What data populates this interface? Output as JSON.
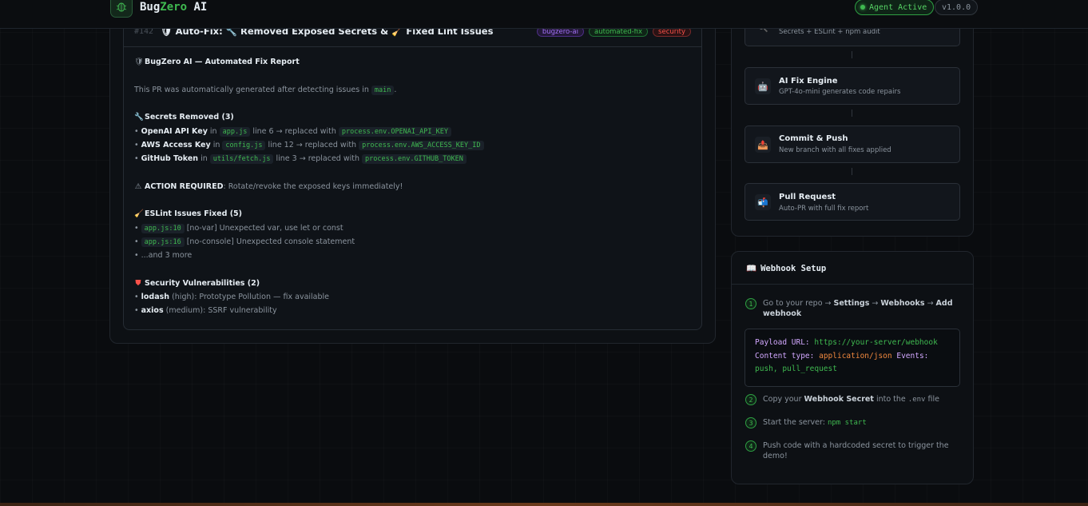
{
  "header": {
    "brand_part1": "Bug",
    "brand_part2": "Zero",
    "brand_part3": " AI",
    "status_badge": "Agent Active",
    "version": "v1.0.0"
  },
  "pr": {
    "number": "#142",
    "title": "🛡 Auto-Fix: 🔧 Removed Exposed Secrets & 🧹 Fixed Lint Issues",
    "tags": [
      "bugzero-ai",
      "automated-fix",
      "security"
    ],
    "report_title": "BugZero AI — Automated Fix Report",
    "intro_text": "This PR was automatically generated after detecting issues in",
    "intro_branch": "main",
    "intro_end": ".",
    "secrets_heading": "Secrets Removed (3)",
    "secrets": [
      {
        "name": "OpenAI API Key",
        "in": "in",
        "file": "app.js",
        "detail": "line 6 → replaced with",
        "replacement": "process.env.OPENAI_API_KEY"
      },
      {
        "name": "AWS Access Key",
        "in": "in",
        "file": "config.js",
        "detail": "line 12 → replaced with",
        "replacement": "process.env.AWS_ACCESS_KEY_ID"
      },
      {
        "name": "GitHub Token",
        "in": "in",
        "file": "utils/fetch.js",
        "detail": "line 3 → replaced with",
        "replacement": "process.env.GITHUB_TOKEN"
      }
    ],
    "action_label": "ACTION REQUIRED",
    "action_text": ": Rotate/revoke the exposed keys immediately!",
    "eslint_heading": "ESLint Issues Fixed (5)",
    "eslint": [
      {
        "loc": "app.js:10",
        "text": "[no-var] Unexpected var, use let or const"
      },
      {
        "loc": "app.js:16",
        "text": "[no-console] Unexpected console statement"
      }
    ],
    "eslint_more": "...and 3 more",
    "vuln_heading": "Security Vulnerabilities (2)",
    "vulns": [
      {
        "pkg": "lodash",
        "severity": "(high)",
        "text": ": Prototype Pollution — fix available"
      },
      {
        "pkg": "axios",
        "severity": "(medium)",
        "text": ": SSRF vulnerability"
      }
    ]
  },
  "pipeline": {
    "partial_desc": "Secrets + ESLint + npm audit",
    "steps": [
      {
        "title": "AI Fix Engine",
        "desc": "GPT-4o-mini generates code repairs"
      },
      {
        "title": "Commit & Push",
        "desc": "New branch with all fixes applied"
      },
      {
        "title": "Pull Request",
        "desc": "Auto-PR with full fix report"
      }
    ]
  },
  "webhook": {
    "title": "Webhook Setup",
    "step1_pre": "Go to your repo → ",
    "step1_b1": "Settings",
    "step1_mid1": " → ",
    "step1_b2": "Webhooks",
    "step1_mid2": " → ",
    "step1_b3": "Add webhook",
    "code_payload_key": "Payload URL:",
    "code_payload_val": "https://your-server/webhook",
    "code_type_key": "Content type:",
    "code_type_val": "application/json",
    "code_events_key": "Events:",
    "code_events_val": "push, pull_request",
    "step2_pre": "Copy your ",
    "step2_b": "Webhook Secret",
    "step2_mid": " into the ",
    "step2_code": ".env",
    "step2_end": " file",
    "step3_pre": "Start the server: ",
    "step3_code": "npm start",
    "step4_text": "Push code with a hardcoded secret to trigger the demo!",
    "numbers": [
      "1",
      "2",
      "3",
      "4"
    ]
  },
  "colors": {
    "accent": "#3fb950",
    "background": "#0a0c0f",
    "danger": "#f85149",
    "purple": "#a371f7"
  }
}
